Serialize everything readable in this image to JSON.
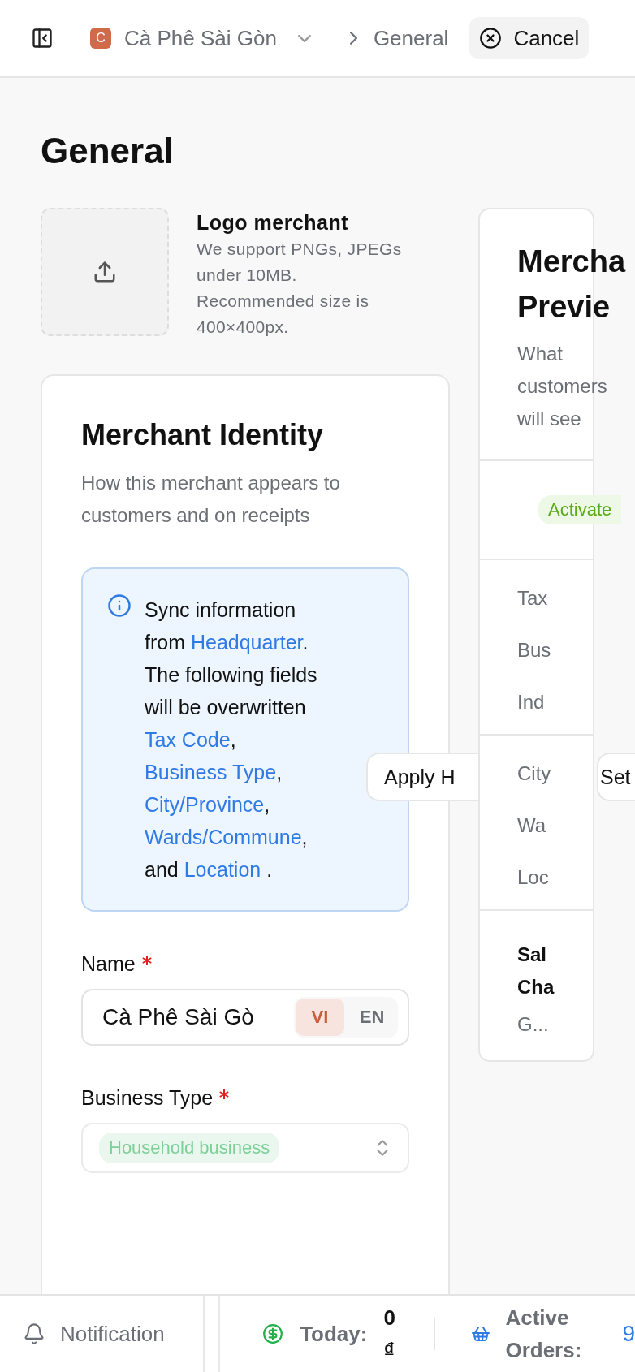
{
  "topbar": {
    "merchant_initial": "C",
    "merchant_name": "Cà Phê Sài Gòn",
    "current_page": "General",
    "cancel_label": "Cancel"
  },
  "page_title": "General",
  "logo_upload": {
    "title": "Logo merchant",
    "description": [
      "We support PNGs, JPEGs under 10MB.",
      "Recommended size is 400×400px."
    ]
  },
  "identity": {
    "title": "Merchant Identity",
    "subtitle": "How this merchant appears to customers and on receipts",
    "notice": [
      {
        "text": "Sync information from ",
        "link": false
      },
      {
        "text": "Headquarter",
        "link": true
      },
      {
        "text": ". The following fields will be overwritten ",
        "link": false
      },
      {
        "text": "Tax Code",
        "link": true
      },
      {
        "text": ", ",
        "link": false
      },
      {
        "text": "Business Type",
        "link": true
      },
      {
        "text": ", ",
        "link": false
      },
      {
        "text": "City/Province",
        "link": true
      },
      {
        "text": ", ",
        "link": false
      },
      {
        "text": "Wards/Commune",
        "link": true
      },
      {
        "text": ", and ",
        "link": false
      },
      {
        "text": "Location",
        "link": true
      },
      {
        "text": " .",
        "link": false
      }
    ],
    "fields": [
      {
        "kind": "text",
        "label": "Name",
        "required": true,
        "value": "Cà Phê Sài Gò",
        "languages": [
          {
            "label": "VI",
            "selected": true
          },
          {
            "label": "EN",
            "selected": false
          }
        ]
      },
      {
        "kind": "select",
        "label": "Business Type",
        "required": true,
        "value": "Household business"
      }
    ]
  },
  "floating_actions": [
    {
      "label": "Apply H"
    },
    {
      "label": "Set"
    }
  ],
  "preview": {
    "title_lines": [
      "Mercha",
      "Previe"
    ],
    "subtitle": "What customers will see",
    "status": "Activate",
    "sections": [
      [
        "Tax",
        "Bus",
        "Ind"
      ],
      [
        "City",
        "Wa",
        "Loc"
      ]
    ],
    "sales": {
      "title_lines": [
        "Sal",
        "Cha"
      ],
      "value": "G..."
    }
  },
  "footer": {
    "notification": "Notification",
    "today_label": "Today:",
    "today_value": "0 ₫",
    "orders_label": "Active Orders:",
    "orders_value": "9"
  }
}
